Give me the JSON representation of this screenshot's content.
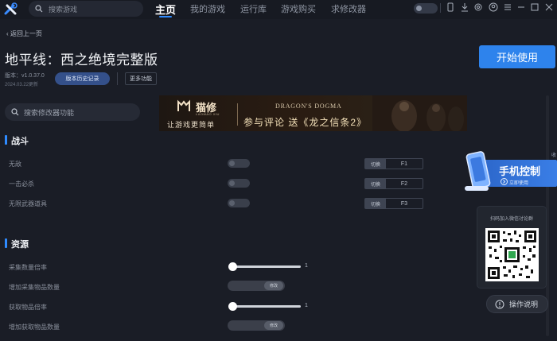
{
  "topbar": {
    "search_placeholder": "搜索游戏",
    "tabs": [
      {
        "label": "主页",
        "active": true
      },
      {
        "label": "我的游戏"
      },
      {
        "label": "运行库"
      },
      {
        "label": "游戏购买"
      },
      {
        "label": "求修改器"
      }
    ],
    "tray_icons": [
      "toggle-switch-icon",
      "phone-icon",
      "download-icon",
      "gear-icon",
      "user-icon",
      "menu-icon",
      "minimize-icon",
      "maximize-icon",
      "close-icon"
    ]
  },
  "header": {
    "back_label": "返回上一页",
    "game_title": "地平线：西之绝境完整版",
    "version": "版本：v1.0.37.0",
    "date": "2024.03.22更新",
    "history_label": "版本历史记录",
    "more_label": "更多功能",
    "start_label": "开始使用"
  },
  "mod_search": {
    "placeholder": "搜索修改器功能"
  },
  "banner": {
    "brand": "猫修",
    "brand_sub": "LAOMAO XIU",
    "slogan": "让游戏更简单",
    "game": "DRAGON'S DOGMA",
    "promo": "参与评论 送《龙之信条2》"
  },
  "sections": [
    {
      "title": "战斗",
      "rows": [
        {
          "label": "无敌",
          "type": "toggle",
          "on": false,
          "hotkey_action": "切换",
          "hotkey": "F1"
        },
        {
          "label": "一击必杀",
          "type": "toggle",
          "on": false,
          "hotkey_action": "切换",
          "hotkey": "F2"
        },
        {
          "label": "无限武器道具",
          "type": "toggle",
          "on": false,
          "hotkey_action": "切换",
          "hotkey": "F3"
        }
      ]
    },
    {
      "title": "资源",
      "rows": [
        {
          "label": "采集数量倍率",
          "type": "slider",
          "value": "1"
        },
        {
          "label": "增加采集物品数量",
          "type": "modify",
          "action": "修改"
        },
        {
          "label": "获取物品倍率",
          "type": "slider",
          "value": "1"
        },
        {
          "label": "增加获取物品数量",
          "type": "modify",
          "action": "修改"
        }
      ]
    }
  ],
  "mobile_promo": {
    "title": "手机控制",
    "sub": "立即使用",
    "close": "收"
  },
  "qr_panel": {
    "title": "扫码加入微信讨论群"
  },
  "help": {
    "label": "操作说明"
  },
  "colors": {
    "accent": "#2e83ec",
    "background": "#1a1d26",
    "panel": "#22262f"
  }
}
